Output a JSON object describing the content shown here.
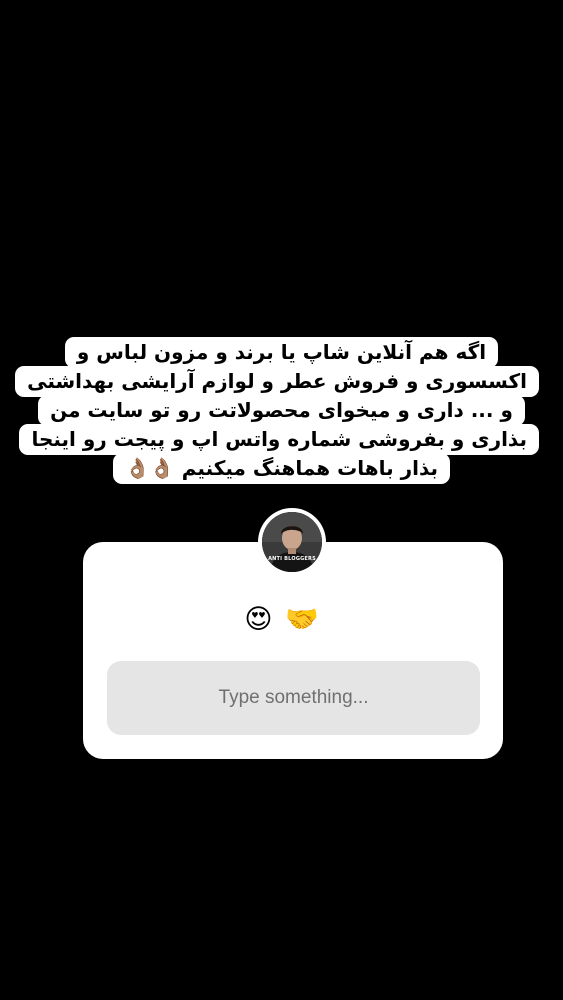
{
  "story": {
    "background_color": "#000000",
    "caption_lines": [
      "اگه هم آنلاین شاپ یا برند و مزون لباس و",
      "اکسسوری و فروش عطر و لوازم آرایشی بهداشتی",
      "و ... داری و میخوای محصولاتت رو تو سایت من",
      "بذاری و بفروشی شماره واتس اپ و پیجت رو اینجا",
      "بذار باهات هماهنگ میکنیم 👌🏽👌🏽"
    ]
  },
  "question_sticker": {
    "avatar": {
      "label": "ANTI BLOGGERS",
      "icon": "profile-photo"
    },
    "prompt_emojis": [
      "😍",
      "🤝"
    ],
    "answer_placeholder": "Type something...",
    "colors": {
      "card": "#ffffff",
      "input": "#e5e5e5",
      "placeholder": "#707070"
    }
  }
}
